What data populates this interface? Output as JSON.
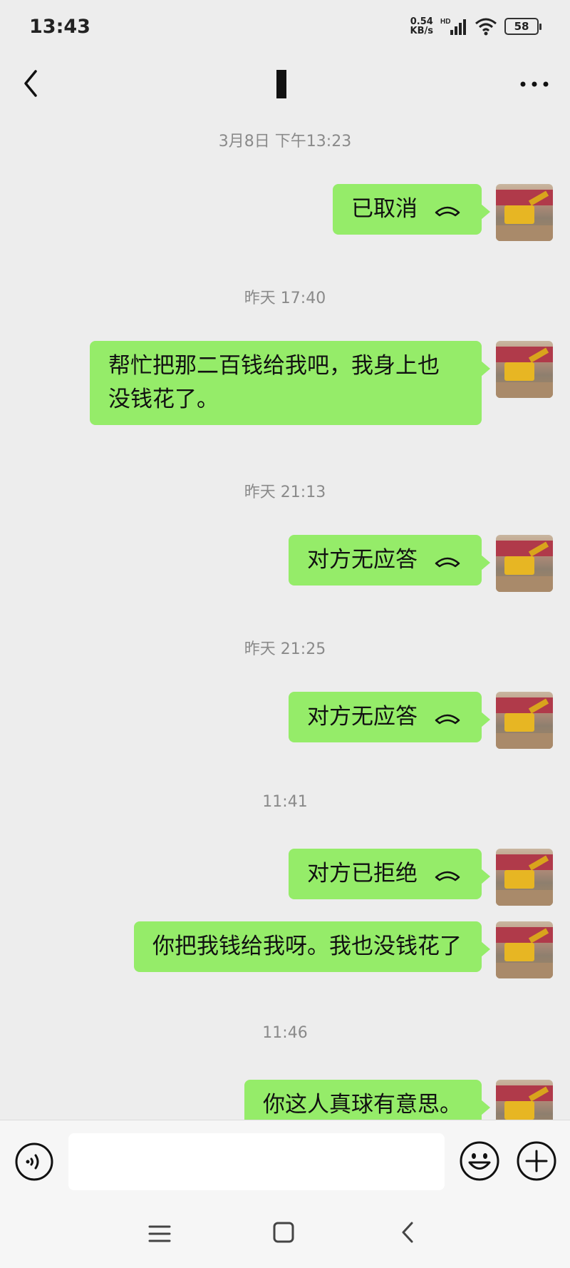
{
  "status_bar": {
    "time": "13:43",
    "speed_value": "0.54",
    "speed_unit": "KB/s",
    "hd": "HD",
    "battery": "58"
  },
  "nav": {
    "back_icon": "chevron-left-icon",
    "more_icon": "more-dots-icon"
  },
  "messages": [
    {
      "timestamp": "3月8日 下午13:23",
      "text": "已取消",
      "call": true
    },
    {
      "timestamp": "昨天 17:40",
      "text_lines": [
        "帮忙把那二百钱给我吧，我身上也",
        "没钱花了。"
      ],
      "call": false
    },
    {
      "timestamp": "昨天 21:13",
      "text": "对方无应答",
      "call": true
    },
    {
      "timestamp": "昨天 21:25",
      "text": "对方无应答",
      "call": true
    },
    {
      "timestamp": "11:41",
      "text": "对方已拒绝",
      "call": true
    },
    {
      "text": "你把我钱给我呀。我也没钱花了",
      "call": false
    },
    {
      "timestamp": "11:46",
      "text": "你这人真球有意思。",
      "call": false
    }
  ],
  "input_bar": {
    "voice_icon": "voice-icon",
    "emoji_icon": "emoji-icon",
    "plus_icon": "plus-icon",
    "input_value": ""
  },
  "accent_color": "#95ec69"
}
